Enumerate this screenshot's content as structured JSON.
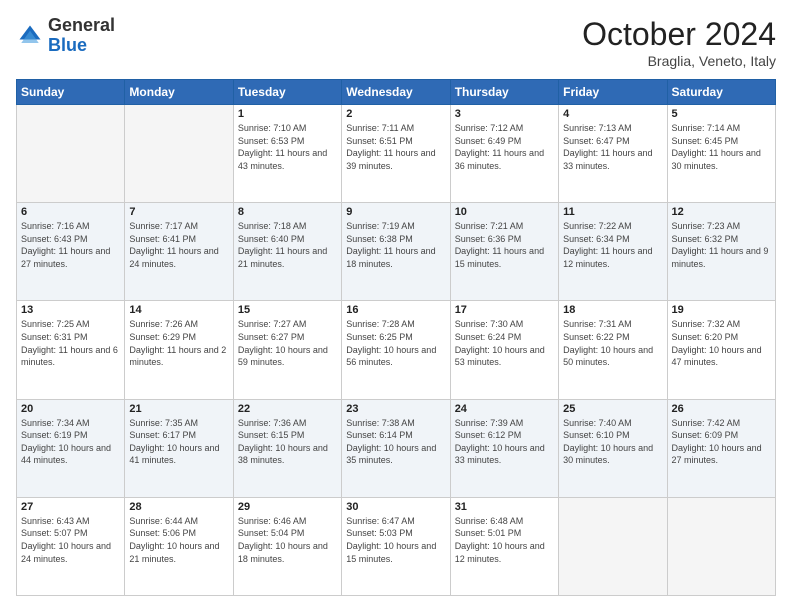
{
  "header": {
    "logo_general": "General",
    "logo_blue": "Blue",
    "month": "October 2024",
    "location": "Braglia, Veneto, Italy"
  },
  "weekdays": [
    "Sunday",
    "Monday",
    "Tuesday",
    "Wednesday",
    "Thursday",
    "Friday",
    "Saturday"
  ],
  "weeks": [
    [
      {
        "day": "",
        "sunrise": "",
        "sunset": "",
        "daylight": ""
      },
      {
        "day": "",
        "sunrise": "",
        "sunset": "",
        "daylight": ""
      },
      {
        "day": "1",
        "sunrise": "Sunrise: 7:10 AM",
        "sunset": "Sunset: 6:53 PM",
        "daylight": "Daylight: 11 hours and 43 minutes."
      },
      {
        "day": "2",
        "sunrise": "Sunrise: 7:11 AM",
        "sunset": "Sunset: 6:51 PM",
        "daylight": "Daylight: 11 hours and 39 minutes."
      },
      {
        "day": "3",
        "sunrise": "Sunrise: 7:12 AM",
        "sunset": "Sunset: 6:49 PM",
        "daylight": "Daylight: 11 hours and 36 minutes."
      },
      {
        "day": "4",
        "sunrise": "Sunrise: 7:13 AM",
        "sunset": "Sunset: 6:47 PM",
        "daylight": "Daylight: 11 hours and 33 minutes."
      },
      {
        "day": "5",
        "sunrise": "Sunrise: 7:14 AM",
        "sunset": "Sunset: 6:45 PM",
        "daylight": "Daylight: 11 hours and 30 minutes."
      }
    ],
    [
      {
        "day": "6",
        "sunrise": "Sunrise: 7:16 AM",
        "sunset": "Sunset: 6:43 PM",
        "daylight": "Daylight: 11 hours and 27 minutes."
      },
      {
        "day": "7",
        "sunrise": "Sunrise: 7:17 AM",
        "sunset": "Sunset: 6:41 PM",
        "daylight": "Daylight: 11 hours and 24 minutes."
      },
      {
        "day": "8",
        "sunrise": "Sunrise: 7:18 AM",
        "sunset": "Sunset: 6:40 PM",
        "daylight": "Daylight: 11 hours and 21 minutes."
      },
      {
        "day": "9",
        "sunrise": "Sunrise: 7:19 AM",
        "sunset": "Sunset: 6:38 PM",
        "daylight": "Daylight: 11 hours and 18 minutes."
      },
      {
        "day": "10",
        "sunrise": "Sunrise: 7:21 AM",
        "sunset": "Sunset: 6:36 PM",
        "daylight": "Daylight: 11 hours and 15 minutes."
      },
      {
        "day": "11",
        "sunrise": "Sunrise: 7:22 AM",
        "sunset": "Sunset: 6:34 PM",
        "daylight": "Daylight: 11 hours and 12 minutes."
      },
      {
        "day": "12",
        "sunrise": "Sunrise: 7:23 AM",
        "sunset": "Sunset: 6:32 PM",
        "daylight": "Daylight: 11 hours and 9 minutes."
      }
    ],
    [
      {
        "day": "13",
        "sunrise": "Sunrise: 7:25 AM",
        "sunset": "Sunset: 6:31 PM",
        "daylight": "Daylight: 11 hours and 6 minutes."
      },
      {
        "day": "14",
        "sunrise": "Sunrise: 7:26 AM",
        "sunset": "Sunset: 6:29 PM",
        "daylight": "Daylight: 11 hours and 2 minutes."
      },
      {
        "day": "15",
        "sunrise": "Sunrise: 7:27 AM",
        "sunset": "Sunset: 6:27 PM",
        "daylight": "Daylight: 10 hours and 59 minutes."
      },
      {
        "day": "16",
        "sunrise": "Sunrise: 7:28 AM",
        "sunset": "Sunset: 6:25 PM",
        "daylight": "Daylight: 10 hours and 56 minutes."
      },
      {
        "day": "17",
        "sunrise": "Sunrise: 7:30 AM",
        "sunset": "Sunset: 6:24 PM",
        "daylight": "Daylight: 10 hours and 53 minutes."
      },
      {
        "day": "18",
        "sunrise": "Sunrise: 7:31 AM",
        "sunset": "Sunset: 6:22 PM",
        "daylight": "Daylight: 10 hours and 50 minutes."
      },
      {
        "day": "19",
        "sunrise": "Sunrise: 7:32 AM",
        "sunset": "Sunset: 6:20 PM",
        "daylight": "Daylight: 10 hours and 47 minutes."
      }
    ],
    [
      {
        "day": "20",
        "sunrise": "Sunrise: 7:34 AM",
        "sunset": "Sunset: 6:19 PM",
        "daylight": "Daylight: 10 hours and 44 minutes."
      },
      {
        "day": "21",
        "sunrise": "Sunrise: 7:35 AM",
        "sunset": "Sunset: 6:17 PM",
        "daylight": "Daylight: 10 hours and 41 minutes."
      },
      {
        "day": "22",
        "sunrise": "Sunrise: 7:36 AM",
        "sunset": "Sunset: 6:15 PM",
        "daylight": "Daylight: 10 hours and 38 minutes."
      },
      {
        "day": "23",
        "sunrise": "Sunrise: 7:38 AM",
        "sunset": "Sunset: 6:14 PM",
        "daylight": "Daylight: 10 hours and 35 minutes."
      },
      {
        "day": "24",
        "sunrise": "Sunrise: 7:39 AM",
        "sunset": "Sunset: 6:12 PM",
        "daylight": "Daylight: 10 hours and 33 minutes."
      },
      {
        "day": "25",
        "sunrise": "Sunrise: 7:40 AM",
        "sunset": "Sunset: 6:10 PM",
        "daylight": "Daylight: 10 hours and 30 minutes."
      },
      {
        "day": "26",
        "sunrise": "Sunrise: 7:42 AM",
        "sunset": "Sunset: 6:09 PM",
        "daylight": "Daylight: 10 hours and 27 minutes."
      }
    ],
    [
      {
        "day": "27",
        "sunrise": "Sunrise: 6:43 AM",
        "sunset": "Sunset: 5:07 PM",
        "daylight": "Daylight: 10 hours and 24 minutes."
      },
      {
        "day": "28",
        "sunrise": "Sunrise: 6:44 AM",
        "sunset": "Sunset: 5:06 PM",
        "daylight": "Daylight: 10 hours and 21 minutes."
      },
      {
        "day": "29",
        "sunrise": "Sunrise: 6:46 AM",
        "sunset": "Sunset: 5:04 PM",
        "daylight": "Daylight: 10 hours and 18 minutes."
      },
      {
        "day": "30",
        "sunrise": "Sunrise: 6:47 AM",
        "sunset": "Sunset: 5:03 PM",
        "daylight": "Daylight: 10 hours and 15 minutes."
      },
      {
        "day": "31",
        "sunrise": "Sunrise: 6:48 AM",
        "sunset": "Sunset: 5:01 PM",
        "daylight": "Daylight: 10 hours and 12 minutes."
      },
      {
        "day": "",
        "sunrise": "",
        "sunset": "",
        "daylight": ""
      },
      {
        "day": "",
        "sunrise": "",
        "sunset": "",
        "daylight": ""
      }
    ]
  ]
}
